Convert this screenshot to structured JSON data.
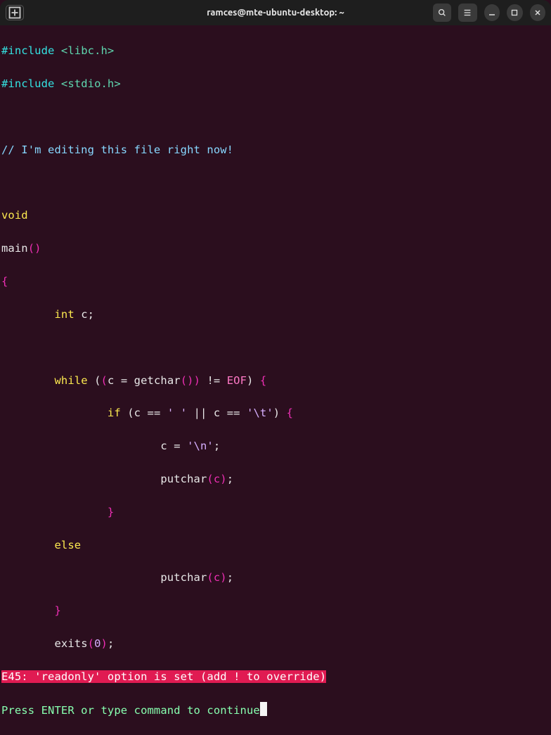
{
  "titlebar": {
    "title": "ramces@mte-ubuntu-desktop: ~"
  },
  "code": {
    "include1_kw": "#include",
    "include1_hdr": "<libc.h>",
    "include2_kw": "#include",
    "include2_hdr": "<stdio.h>",
    "comment": "// I'm editing this file right now!",
    "void_kw": "void",
    "main_fn": "main",
    "main_parens": "()",
    "brace_open": "{",
    "int_kw": "int",
    "var_c": " c;",
    "while_kw": "while",
    "while_open": " (",
    "while_inner_open": "(",
    "while_assign": "c = getchar",
    "while_call": "()",
    "while_inner_close": ")",
    "while_neq": " != ",
    "eof": "EOF",
    "while_close": ")",
    "while_brace": " {",
    "if_kw": "if",
    "if_open": " (",
    "if_c1": "c == ",
    "if_sp": "' '",
    "if_or": " || ",
    "if_c2": "c == ",
    "if_tab": "'\\t'",
    "if_close": ")",
    "if_brace": " {",
    "assign_c": "c = ",
    "nl_char": "'\\n'",
    "semi": ";",
    "putchar1": "putchar",
    "putchar1_args": "(c)",
    "putchar1_semi": ";",
    "brace_close1": "}",
    "else_kw": "else",
    "putchar2": "putchar",
    "putchar2_args": "(c)",
    "putchar2_semi": ";",
    "brace_close2": "}",
    "exits": "exits",
    "exits_open": "(",
    "exits_arg": "0",
    "exits_close": ")",
    "exits_semi": ";"
  },
  "status": {
    "error": "E45: 'readonly' option is set (add ! to override)",
    "prompt": "Press ENTER or type command to continue"
  }
}
